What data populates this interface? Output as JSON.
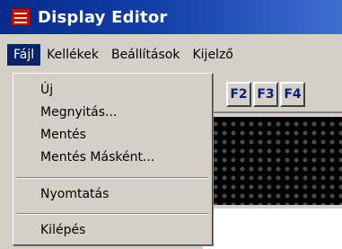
{
  "window": {
    "title": "Display Editor"
  },
  "menubar": {
    "items": [
      {
        "label": "Fájl",
        "active": true
      },
      {
        "label": "Kellékek"
      },
      {
        "label": "Beállítások"
      },
      {
        "label": "Kijelző"
      }
    ]
  },
  "file_menu": {
    "new": "Új",
    "open": "Megnyitás...",
    "save": "Mentés",
    "save_as": "Mentés Másként...",
    "print": "Nyomtatás",
    "exit": "Kilépés"
  },
  "toolbar": {
    "buttons": [
      "F2",
      "F3",
      "F4"
    ]
  },
  "colors": {
    "titlebar": "#0a246a",
    "menu_highlight": "#0a246a",
    "face": "#d4d0c8",
    "led_off": "#4a4a4a"
  }
}
